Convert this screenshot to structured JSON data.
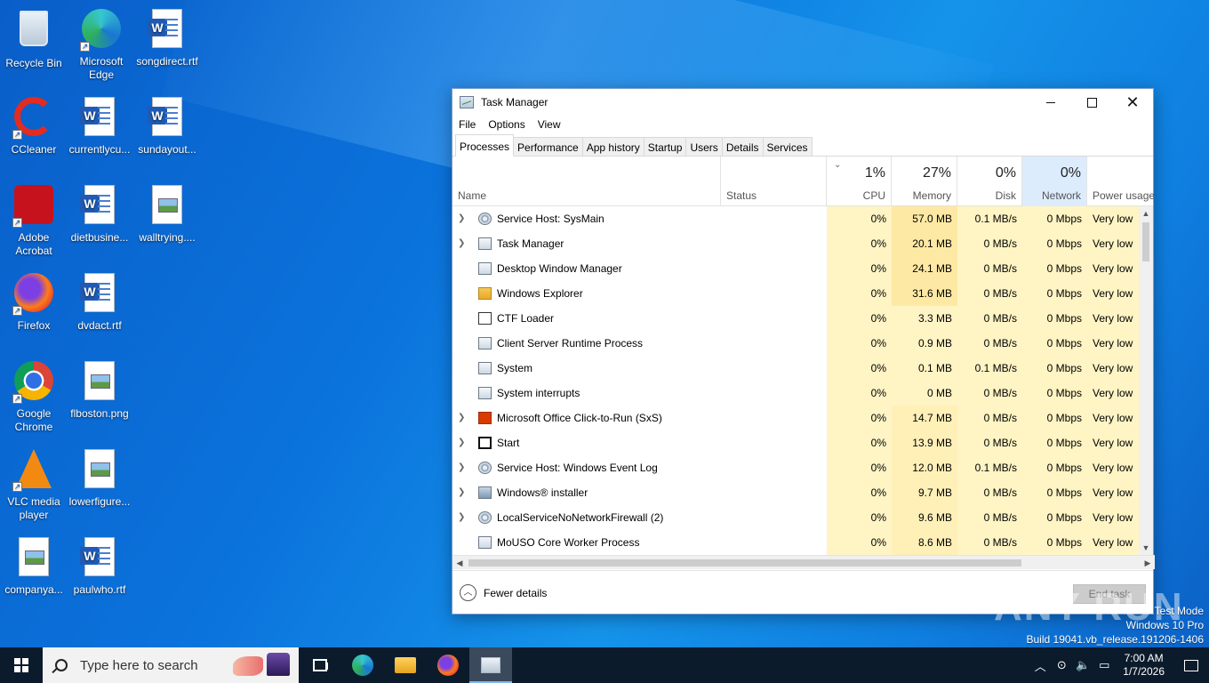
{
  "desktop": {
    "icons": [
      {
        "label": "Recycle Bin",
        "kind": "recycle"
      },
      {
        "label": "Microsoft Edge",
        "kind": "edge"
      },
      {
        "label": "songdirect.rtf",
        "kind": "word"
      },
      {
        "label": "CCleaner",
        "kind": "ccleaner"
      },
      {
        "label": "currentlycu...",
        "kind": "word"
      },
      {
        "label": "sundayout...",
        "kind": "word"
      },
      {
        "label": "Adobe Acrobat",
        "kind": "acrobat"
      },
      {
        "label": "dietbusine...",
        "kind": "word"
      },
      {
        "label": "walltrying....",
        "kind": "image"
      },
      {
        "label": "Firefox",
        "kind": "firefox"
      },
      {
        "label": "dvdact.rtf",
        "kind": "word"
      },
      {
        "label": "Google Chrome",
        "kind": "chrome"
      },
      {
        "label": "flboston.png",
        "kind": "image"
      },
      {
        "label": "VLC media player",
        "kind": "vlc"
      },
      {
        "label": "lowerfigure...",
        "kind": "image"
      },
      {
        "label": "companya...",
        "kind": "image"
      },
      {
        "label": "paulwho.rtf",
        "kind": "word"
      }
    ]
  },
  "window": {
    "title": "Task Manager",
    "menu": [
      "File",
      "Options",
      "View"
    ],
    "tabs": [
      "Processes",
      "Performance",
      "App history",
      "Startup",
      "Users",
      "Details",
      "Services"
    ],
    "active_tab": "Processes",
    "columns": {
      "name": "Name",
      "status": "Status",
      "cpu": {
        "pct": "1%",
        "label": "CPU"
      },
      "memory": {
        "pct": "27%",
        "label": "Memory"
      },
      "disk": {
        "pct": "0%",
        "label": "Disk"
      },
      "network": {
        "pct": "0%",
        "label": "Network"
      },
      "power": {
        "label": "Power usage"
      }
    },
    "processes": [
      {
        "name": "Service Host: SysMain",
        "expandable": true,
        "icon": "gear",
        "cpu": "0%",
        "memory": "57.0 MB",
        "disk": "0.1 MB/s",
        "network": "0 Mbps",
        "power": "Very low"
      },
      {
        "name": "Task Manager",
        "expandable": true,
        "icon": "taskmgr",
        "cpu": "0%",
        "memory": "20.1 MB",
        "disk": "0 MB/s",
        "network": "0 Mbps",
        "power": "Very low"
      },
      {
        "name": "Desktop Window Manager",
        "expandable": false,
        "icon": "window",
        "cpu": "0%",
        "memory": "24.1 MB",
        "disk": "0 MB/s",
        "network": "0 Mbps",
        "power": "Very low"
      },
      {
        "name": "Windows Explorer",
        "expandable": false,
        "icon": "folder",
        "cpu": "0%",
        "memory": "31.6 MB",
        "disk": "0 MB/s",
        "network": "0 Mbps",
        "power": "Very low"
      },
      {
        "name": "CTF Loader",
        "expandable": false,
        "icon": "pen",
        "cpu": "0%",
        "memory": "3.3 MB",
        "disk": "0 MB/s",
        "network": "0 Mbps",
        "power": "Very low"
      },
      {
        "name": "Client Server Runtime Process",
        "expandable": false,
        "icon": "window",
        "cpu": "0%",
        "memory": "0.9 MB",
        "disk": "0 MB/s",
        "network": "0 Mbps",
        "power": "Very low"
      },
      {
        "name": "System",
        "expandable": false,
        "icon": "window",
        "cpu": "0%",
        "memory": "0.1 MB",
        "disk": "0.1 MB/s",
        "network": "0 Mbps",
        "power": "Very low"
      },
      {
        "name": "System interrupts",
        "expandable": false,
        "icon": "window",
        "cpu": "0%",
        "memory": "0 MB",
        "disk": "0 MB/s",
        "network": "0 Mbps",
        "power": "Very low"
      },
      {
        "name": "Microsoft Office Click-to-Run (SxS)",
        "expandable": true,
        "icon": "office",
        "cpu": "0%",
        "memory": "14.7 MB",
        "disk": "0 MB/s",
        "network": "0 Mbps",
        "power": "Very low"
      },
      {
        "name": "Start",
        "expandable": true,
        "icon": "start",
        "cpu": "0%",
        "memory": "13.9 MB",
        "disk": "0 MB/s",
        "network": "0 Mbps",
        "power": "Very low"
      },
      {
        "name": "Service Host: Windows Event Log",
        "expandable": true,
        "icon": "gear",
        "cpu": "0%",
        "memory": "12.0 MB",
        "disk": "0.1 MB/s",
        "network": "0 Mbps",
        "power": "Very low"
      },
      {
        "name": "Windows® installer",
        "expandable": true,
        "icon": "installer",
        "cpu": "0%",
        "memory": "9.7 MB",
        "disk": "0 MB/s",
        "network": "0 Mbps",
        "power": "Very low"
      },
      {
        "name": "LocalServiceNoNetworkFirewall (2)",
        "expandable": true,
        "icon": "gear",
        "cpu": "0%",
        "memory": "9.6 MB",
        "disk": "0 MB/s",
        "network": "0 Mbps",
        "power": "Very low"
      },
      {
        "name": "MoUSO Core Worker Process",
        "expandable": false,
        "icon": "window",
        "cpu": "0%",
        "memory": "8.6 MB",
        "disk": "0 MB/s",
        "network": "0 Mbps",
        "power": "Very low"
      }
    ],
    "footer": {
      "fewer_details": "Fewer details",
      "end_task": "End task"
    }
  },
  "watermark": {
    "text": "ANY RUN",
    "mode_lines": [
      "Test Mode",
      "Windows 10 Pro",
      "Build 19041.vb_release.191206-1406"
    ]
  },
  "taskbar": {
    "search_placeholder": "Type here to search",
    "clock_time": "7:00 AM",
    "clock_date": "1/7/2026"
  }
}
